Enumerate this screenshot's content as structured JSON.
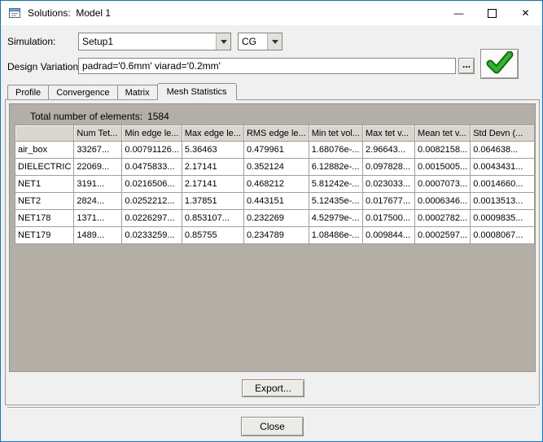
{
  "colors": {
    "window_border": "#0f74cc",
    "titlebar_bg": "#ffffff",
    "dialog_bg": "#f0f0f0",
    "panel_bg": "#b3afa6",
    "table_header_bg": "#d9d6cf",
    "check_green": "#2fb52f"
  },
  "window": {
    "title": "Solutions:  Model 1"
  },
  "icons": {
    "minimize": "—",
    "maximize": "maximize-box",
    "close": "✕",
    "dropdown": "▼",
    "checkmark": "✓"
  },
  "toolbar": {
    "simulation_label": "Simulation:",
    "simulation_value": "Setup1",
    "matrix_type_value": "CG",
    "design_variation_label": "Design Variation:",
    "design_variation_value": "padrad='0.6mm' viarad='0.2mm'",
    "browse_label": "..."
  },
  "tabs": [
    {
      "label": "Profile"
    },
    {
      "label": "Convergence"
    },
    {
      "label": "Matrix"
    },
    {
      "label": "Mesh Statistics"
    }
  ],
  "mesh_statistics": {
    "total_label": "Total number of elements:",
    "total_value": "1584",
    "export_label": "Export...",
    "table": {
      "headers": [
        "",
        "Num Tet...",
        "Min edge le...",
        "Max edge le...",
        "RMS edge le...",
        "Min tet vol...",
        "Max tet v...",
        "Mean tet v...",
        "Std Devn (..."
      ],
      "rows": [
        {
          "name": "air_box",
          "cells": [
            "33267...",
            "0.00791126...",
            "5.36463",
            "0.479961",
            "1.68076e-...",
            "2.96643...",
            "0.0082158...",
            "0.064638..."
          ]
        },
        {
          "name": "DIELECTRIC",
          "cells": [
            "22069...",
            "0.0475833...",
            "2.17141",
            "0.352124",
            "6.12882e-...",
            "0.097828...",
            "0.0015005...",
            "0.0043431..."
          ]
        },
        {
          "name": "NET1",
          "cells": [
            "3191...",
            "0.0216506...",
            "2.17141",
            "0.468212",
            "5.81242e-...",
            "0.023033...",
            "0.0007073...",
            "0.0014660..."
          ]
        },
        {
          "name": "NET2",
          "cells": [
            "2824...",
            "0.0252212...",
            "1.37851",
            "0.443151",
            "5.12435e-...",
            "0.017677...",
            "0.0006346...",
            "0.0013513..."
          ]
        },
        {
          "name": "NET178",
          "cells": [
            "1371...",
            "0.0226297...",
            "0.853107...",
            "0.232269",
            "4.52979e-...",
            "0.017500...",
            "0.0002782...",
            "0.0009835..."
          ]
        },
        {
          "name": "NET179",
          "cells": [
            "1489...",
            "0.0233259...",
            "0.85755",
            "0.234789",
            "1.08486e-...",
            "0.009844...",
            "0.0002597...",
            "0.0008067..."
          ]
        }
      ]
    }
  },
  "footer": {
    "close_label": "Close"
  }
}
